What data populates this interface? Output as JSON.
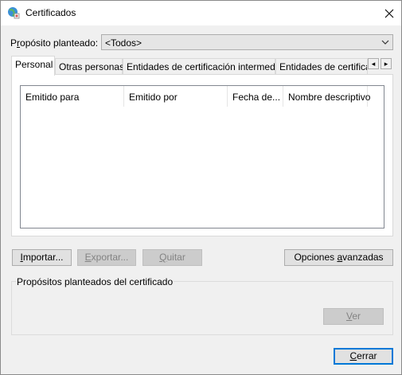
{
  "window": {
    "title": "Certificados",
    "close_glyph": "✕",
    "accent": "#0078d7"
  },
  "purpose": {
    "label_prefix": "P",
    "label_mnemonic": "r",
    "label_suffix": "opósito planteado:",
    "value": "<Todos>"
  },
  "tabs": [
    {
      "label": "Personal",
      "active": true
    },
    {
      "label": "Otras personas"
    },
    {
      "label": "Entidades de certificación intermedias"
    },
    {
      "label": "Entidades de certificaci"
    }
  ],
  "tab_scroll": {
    "left": "◂",
    "right": "▸"
  },
  "columns": [
    "Emitido para",
    "Emitido por",
    "Fecha de...",
    "Nombre descriptivo"
  ],
  "buttons": {
    "import": {
      "mnemonic": "I",
      "rest": "mportar..."
    },
    "export": {
      "mnemonic": "E",
      "rest": "xportar..."
    },
    "remove": {
      "mnemonic": "Q",
      "rest": "uitar"
    },
    "advanced": {
      "pre": "Opciones ",
      "mnemonic": "a",
      "rest": "vanzadas"
    },
    "view": {
      "mnemonic": "V",
      "rest": "er"
    },
    "close": {
      "mnemonic": "C",
      "rest": "errar"
    }
  },
  "group": {
    "title": "Propósitos planteados del certificado"
  },
  "icons": {
    "app": "certificate-globe-icon",
    "dropdown": "chevron-down-icon"
  }
}
